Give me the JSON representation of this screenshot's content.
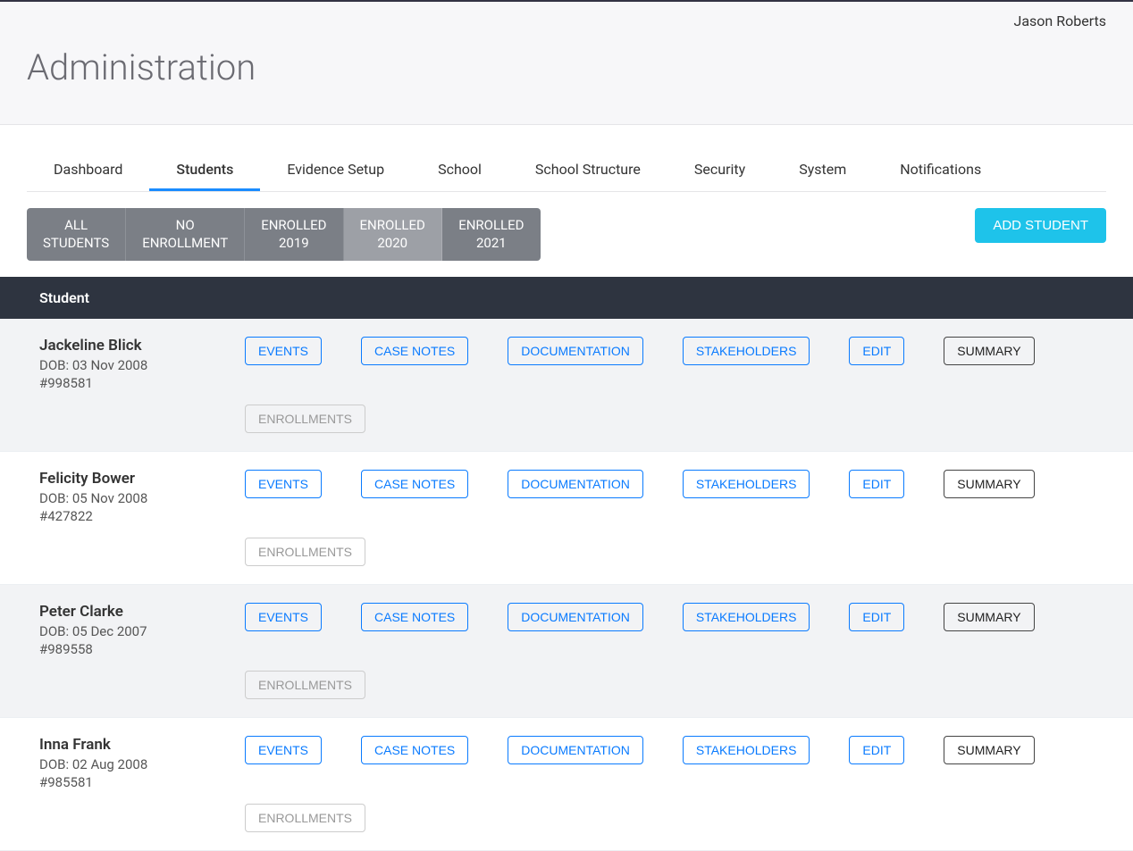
{
  "header": {
    "user_name": "Jason Roberts",
    "page_title": "Administration"
  },
  "tabs": [
    {
      "label": "Dashboard",
      "active": false
    },
    {
      "label": "Students",
      "active": true
    },
    {
      "label": "Evidence Setup",
      "active": false
    },
    {
      "label": "School",
      "active": false
    },
    {
      "label": "School Structure",
      "active": false
    },
    {
      "label": "Security",
      "active": false
    },
    {
      "label": "System",
      "active": false
    },
    {
      "label": "Notifications",
      "active": false
    }
  ],
  "filter_tabs": [
    {
      "line1": "ALL",
      "line2": "STUDENTS",
      "active": false
    },
    {
      "line1": "NO",
      "line2": "ENROLLMENT",
      "active": false
    },
    {
      "line1": "ENROLLED",
      "line2": "2019",
      "active": false
    },
    {
      "line1": "ENROLLED",
      "line2": "2020",
      "active": true
    },
    {
      "line1": "ENROLLED",
      "line2": "2021",
      "active": false
    }
  ],
  "add_student_label": "ADD STUDENT",
  "table": {
    "header": "Student"
  },
  "action_labels": {
    "events": "EVENTS",
    "case_notes": "CASE NOTES",
    "documentation": "DOCUMENTATION",
    "stakeholders": "STAKEHOLDERS",
    "edit": "EDIT",
    "summary": "SUMMARY",
    "enrollments": "ENROLLMENTS"
  },
  "students": [
    {
      "name": "Jackeline Blick",
      "dob": "DOB: 03 Nov 2008",
      "id": "#998581"
    },
    {
      "name": "Felicity Bower",
      "dob": "DOB: 05 Nov 2008",
      "id": "#427822"
    },
    {
      "name": "Peter Clarke",
      "dob": "DOB: 05 Dec 2007",
      "id": "#989558"
    },
    {
      "name": "Inna Frank",
      "dob": "DOB: 02 Aug 2008",
      "id": "#985581"
    }
  ]
}
